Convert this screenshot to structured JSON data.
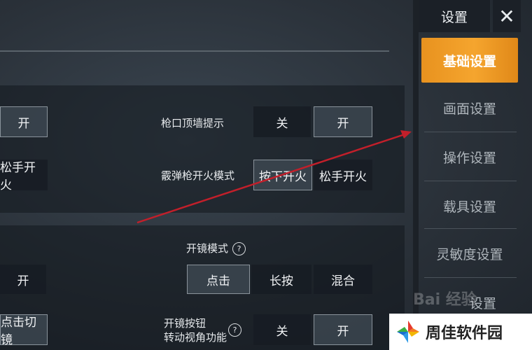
{
  "sidebar": {
    "title": "设置",
    "close": "✕",
    "items": [
      {
        "label": "基础设置",
        "active": true
      },
      {
        "label": "画面设置",
        "active": false
      },
      {
        "label": "操作设置",
        "active": false
      },
      {
        "label": "载具设置",
        "active": false
      },
      {
        "label": "灵敏度设置",
        "active": false
      },
      {
        "label": "设置",
        "active": false
      }
    ]
  },
  "section1": {
    "left_row1_btn": "开",
    "left_row2_btn": "松手开火",
    "muzzle_wall": {
      "label": "枪口顶墙提示",
      "off": "关",
      "on": "开",
      "selected": "开"
    },
    "shotgun_fire": {
      "label": "霰弹枪开火模式",
      "press": "按下开火",
      "release": "松手开火",
      "selected": "按下开火"
    }
  },
  "section2": {
    "left_row1_btn": "开",
    "left_row2_btn": "点击切镜",
    "scope_mode": {
      "label": "开镜模式",
      "help": "?",
      "options": [
        "点击",
        "长按",
        "混合"
      ],
      "selected": "点击"
    },
    "scope_button": {
      "label_line1": "开镜按钮",
      "label_line2": "转动视角功能",
      "help": "?",
      "off": "关",
      "on": "开",
      "selected": "开"
    }
  },
  "watermark": {
    "text": "Bai 经验"
  },
  "brand": {
    "name": "周佳软件园"
  },
  "colors": {
    "accent": "#f5a52e",
    "arrow": "#c21f2a"
  }
}
